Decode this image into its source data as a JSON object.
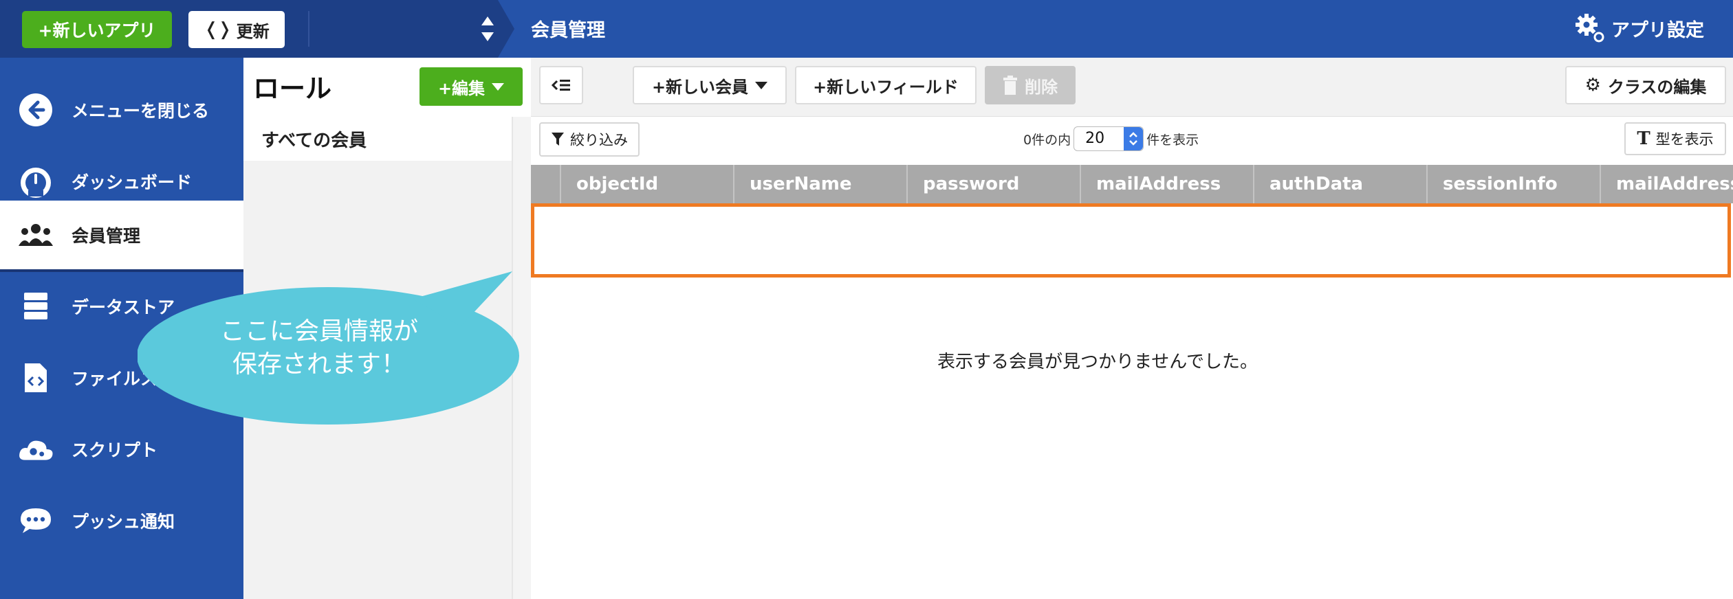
{
  "topbar": {
    "new_app_label": "+新しいアプリ",
    "refresh_label": "更新",
    "refresh_icon_glyph": "❬❭",
    "page_title": "会員管理",
    "app_settings_label": "アプリ設定"
  },
  "sidebar": {
    "items": [
      {
        "label": "メニューを閉じる",
        "icon": "arrow-left-circle-icon"
      },
      {
        "label": "ダッシュボード",
        "icon": "gauge-icon"
      },
      {
        "label": "会員管理",
        "icon": "users-icon",
        "active": true
      },
      {
        "label": "データストア",
        "icon": "database-icon"
      },
      {
        "label": "ファイルス",
        "icon": "file-code-icon"
      },
      {
        "label": "スクリプト",
        "icon": "cloud-gears-icon"
      },
      {
        "label": "プッシュ通知",
        "icon": "chat-bubble-icon"
      }
    ]
  },
  "roles": {
    "title": "ロール",
    "edit_label": "+編集",
    "all_members": "すべての会員"
  },
  "toolbar": {
    "new_member_label": "+新しい会員",
    "new_field_label": "+新しいフィールド",
    "delete_label": "削除",
    "edit_class_label": "クラスの編集"
  },
  "filterbar": {
    "filter_label": "絞り込み",
    "count_prefix": "0件の内",
    "page_size": "20",
    "count_suffix": "件を表示",
    "show_type_label": "型を表示"
  },
  "table": {
    "columns": [
      "objectId",
      "userName",
      "password",
      "mailAddress",
      "authData",
      "sessionInfo",
      "mailAddress"
    ],
    "empty_message": "表示する会員が見つかりませんでした。"
  },
  "annotation": {
    "line1": "ここに会員情報が",
    "line2": "保存されます！",
    "bubble_color": "#5bc9dc",
    "highlight_color": "#ef7a22"
  },
  "colors": {
    "brand_blue": "#2553a9",
    "green": "#4cae1d",
    "header_gray": "#a9a9a9"
  }
}
